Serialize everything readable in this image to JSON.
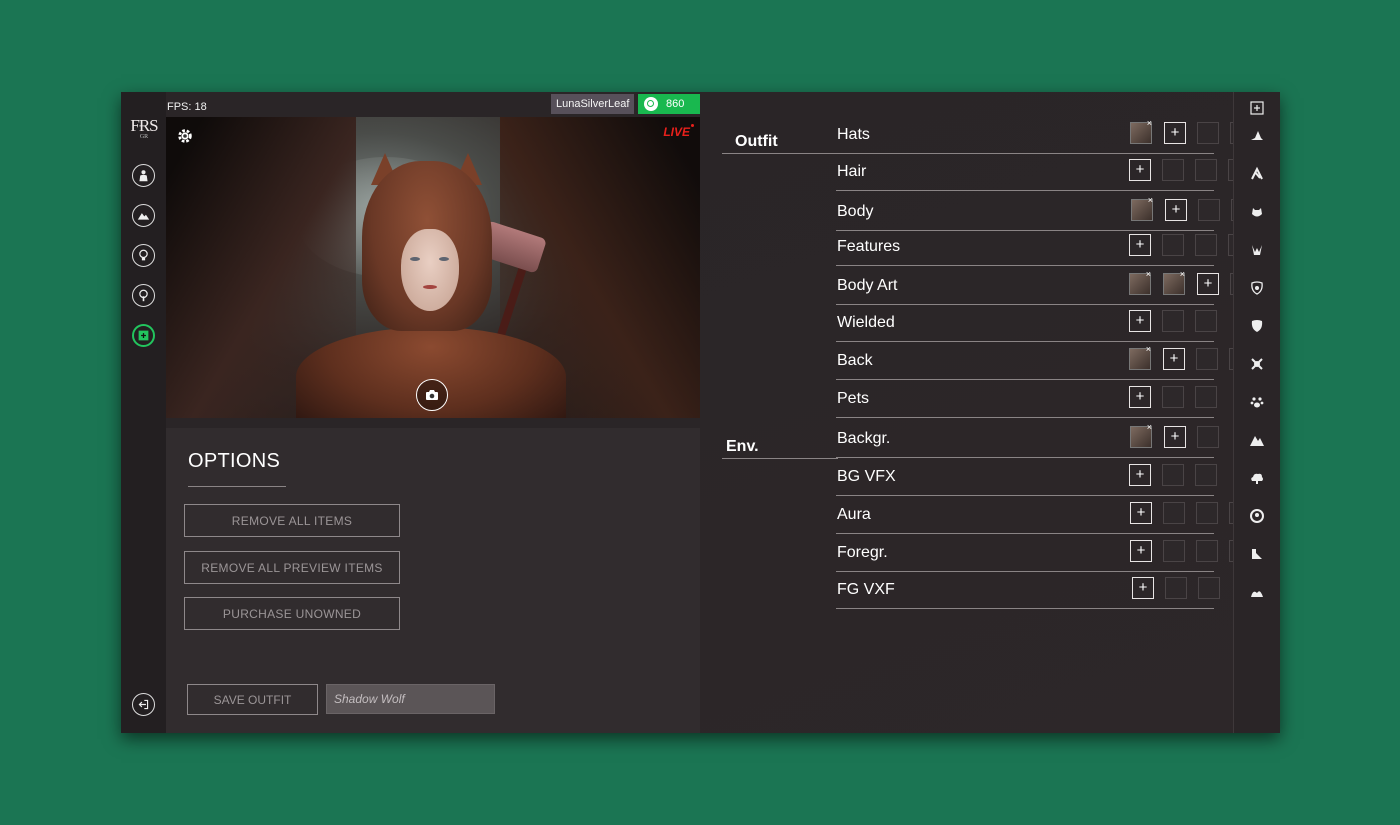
{
  "app": {
    "logo_text": "FɌS",
    "logo_sub": "GR"
  },
  "status": {
    "fps": "FPS: 18",
    "username": "LunaSilverLeaf",
    "coins": "860"
  },
  "preview": {
    "live_label": "LIVE"
  },
  "options": {
    "title": "OPTIONS",
    "remove_all": "REMOVE ALL ITEMS",
    "remove_preview": "REMOVE ALL PREVIEW ITEMS",
    "purchase": "PURCHASE UNOWNED",
    "save_outfit": "SAVE OUTFIT",
    "outfit_name": "Shadow Wolf"
  },
  "sections": {
    "outfit": "Outfit",
    "env": "Env."
  },
  "rows": [
    {
      "label": "Hats",
      "items": 1,
      "empty": 4
    },
    {
      "label": "Hair",
      "items": 0,
      "empty": 4
    },
    {
      "label": "Body",
      "items": 1,
      "empty": 4
    },
    {
      "label": "Features",
      "items": 0,
      "empty": 5
    },
    {
      "label": "Body Art",
      "items": 2,
      "empty": 3
    },
    {
      "label": "Wielded",
      "items": 0,
      "empty": 2
    },
    {
      "label": "Back",
      "items": 1,
      "empty": 2
    },
    {
      "label": "Pets",
      "items": 0,
      "empty": 2
    },
    {
      "label": "Backgr.",
      "items": 1,
      "empty": 1
    },
    {
      "label": "BG VFX",
      "items": 0,
      "empty": 2
    },
    {
      "label": "Aura",
      "items": 0,
      "empty": 4
    },
    {
      "label": "Foregr.",
      "items": 0,
      "empty": 5
    },
    {
      "label": "FG VXF",
      "items": 0,
      "empty": 2
    }
  ],
  "left_nav_icons": [
    "person-icon",
    "landscape-icon",
    "bulb-icon",
    "tree-icon",
    "add-square-icon"
  ],
  "category_icons": [
    "add-square-icon",
    "hat-icon",
    "hair-icon",
    "body-icon",
    "features-icon",
    "body-art-icon",
    "shield-icon",
    "crossed-swords-icon",
    "paw-icon",
    "mountains-icon",
    "cloud-icon",
    "aura-icon",
    "foreground-icon",
    "fg-vfx-icon"
  ],
  "colors": {
    "background": "#1b7553",
    "panel": "#2a2527",
    "coins": "#19b84f",
    "live": "#e8201b",
    "active_nav": "#22c55e"
  }
}
